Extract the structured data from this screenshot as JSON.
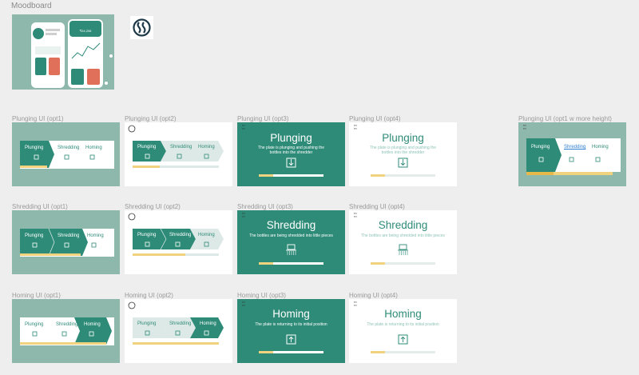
{
  "moodboard": {
    "label": "Moodboard"
  },
  "colors": {
    "teal": "#2e8b78",
    "sage": "#8fb8ad",
    "yellow": "#f1d27e",
    "white": "#ffffff",
    "canvas": "#eeeeee"
  },
  "frames": {
    "plunging_opt1": {
      "label": "Plunging UI (opt1)",
      "steps": [
        "Plunging",
        "Shredding",
        "Homing"
      ]
    },
    "plunging_opt2": {
      "label": "Plunging UI (opt2)",
      "steps": [
        "Plunging",
        "Shredding",
        "Homing"
      ]
    },
    "plunging_opt3": {
      "label": "Plunging UI (opt3)",
      "title": "Plunging",
      "desc": "The plate is plunging and pushing the bottles into the shredder"
    },
    "plunging_opt4": {
      "label": "Plunging UI (opt4)",
      "title": "Plunging",
      "desc": "The plate is plunging and pushing the bottles into the shredder"
    },
    "plunging_opt1_tall": {
      "label": "Plunging UI (opt1 w more height)",
      "steps": [
        "Plunging",
        "Shredding",
        "Homing"
      ]
    },
    "shredding_opt1": {
      "label": "Shredding UI (opt1)",
      "steps": [
        "Plunging",
        "Shredding",
        "Homing"
      ]
    },
    "shredding_opt2": {
      "label": "Shredding UI (opt2)",
      "steps": [
        "Plunging",
        "Shredding",
        "Homing"
      ]
    },
    "shredding_opt3": {
      "label": "Shredding UI (opt3)",
      "title": "Shredding",
      "desc": "The bottles are being shredded into little pieces"
    },
    "shredding_opt4": {
      "label": "Shredding UI (opt4)",
      "title": "Shredding",
      "desc": "The bottles are being shredded into little pieces"
    },
    "homing_opt1": {
      "label": "Homing UI (opt1)",
      "steps": [
        "Plunging",
        "Shredding",
        "Homing"
      ]
    },
    "homing_opt2": {
      "label": "Homing UI (opt2)",
      "steps": [
        "Plunging",
        "Shredding",
        "Homing"
      ]
    },
    "homing_opt3": {
      "label": "Homing UI (opt3)",
      "title": "Homing",
      "desc": "The plate is returning to its initial position"
    },
    "homing_opt4": {
      "label": "Homing UI (opt4)",
      "title": "Homing",
      "desc": "The plate is returning to its initial position"
    }
  }
}
